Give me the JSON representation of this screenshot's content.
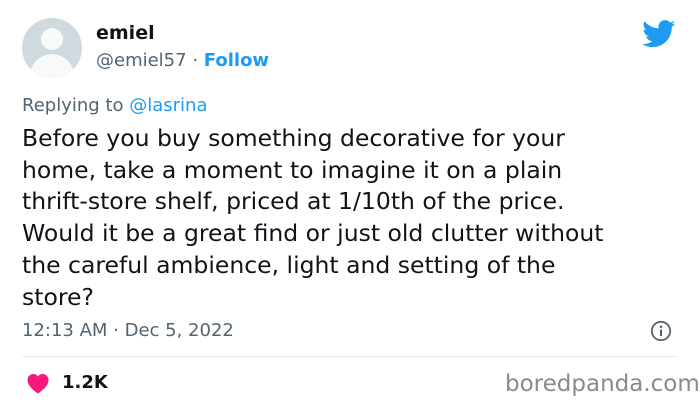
{
  "user": {
    "display_name": "emiel",
    "handle": "@emiel57",
    "separator": "·",
    "follow_label": "Follow"
  },
  "reply": {
    "prefix": "Replying to",
    "mention": "@lasrina"
  },
  "tweet": {
    "text": "Before you buy something decorative for your\nhome, take a moment to imagine it on a plain\nthrift-store shelf, priced at 1/10th of the price.\nWould it be a great find or just old clutter without\nthe careful ambience, light and setting of the\nstore?",
    "timestamp": "12:13 AM · Dec 5, 2022"
  },
  "engagement": {
    "likes": "1.2K"
  },
  "watermark": "boredpanda.com",
  "icons": {
    "brand": "twitter-bird-icon",
    "info": "info-icon",
    "like": "heart-icon"
  },
  "colors": {
    "accent": "#1d9bf0",
    "like": "#f91880",
    "text": "#0f1419",
    "secondary": "#536471"
  }
}
